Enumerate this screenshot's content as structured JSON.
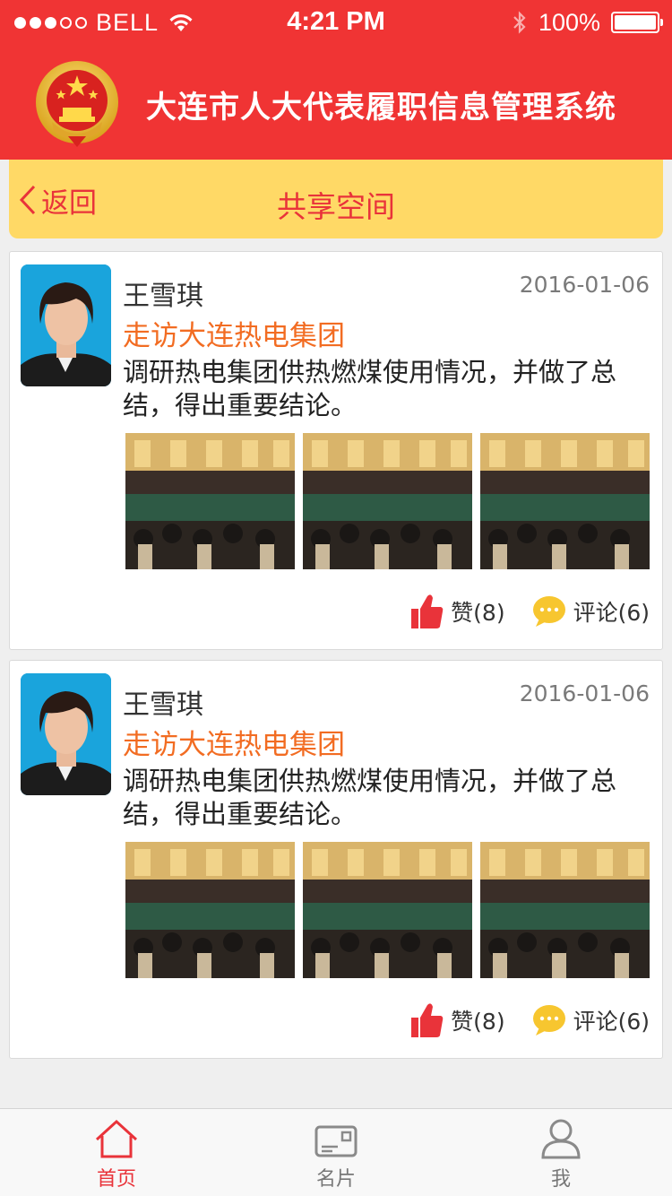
{
  "status_bar": {
    "carrier": "BELL",
    "time": "4:21 PM",
    "battery": "100%"
  },
  "header": {
    "title": "大连市人大代表履职信息管理系统",
    "emblem_icon": "national-emblem-icon"
  },
  "nav": {
    "back_label": "返回",
    "title": "共享空间"
  },
  "posts": [
    {
      "author": "王雪琪",
      "date": "2016-01-06",
      "title": "走访大连热电集团",
      "body": "调研热电集团供热燃煤使用情况，并做了总结，得出重要结论。",
      "like_label": "赞(8)",
      "comment_label": "评论(6)"
    },
    {
      "author": "王雪琪",
      "date": "2016-01-06",
      "title": "走访大连热电集团",
      "body": "调研热电集团供热燃煤使用情况，并做了总结，得出重要结论。",
      "like_label": "赞(8)",
      "comment_label": "评论(6)"
    }
  ],
  "tabbar": {
    "home": "首页",
    "card": "名片",
    "me": "我"
  },
  "colors": {
    "header_red": "#f03434",
    "nav_yellow": "#ffd966",
    "accent_red": "#e9333a",
    "title_orange": "#f26c22",
    "comment_yellow": "#f7c62f"
  }
}
